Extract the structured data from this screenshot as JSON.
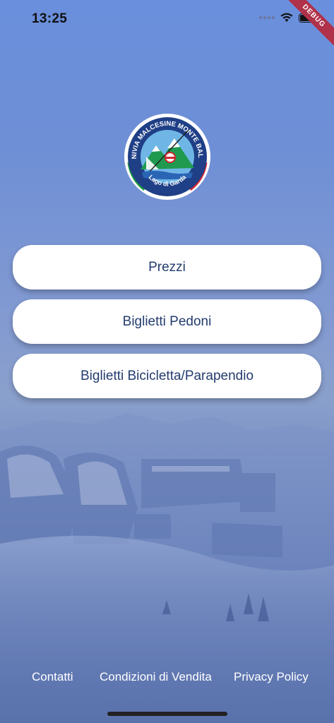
{
  "status_bar": {
    "time": "13:25",
    "icons": [
      "signal-icon",
      "wifi-icon",
      "battery-icon"
    ],
    "debug_label": "DEBUG"
  },
  "logo": {
    "top_text": "FUNIVIA MALCESINE MONTE BALDO",
    "bottom_text": "Lago di Garda"
  },
  "buttons": [
    {
      "label": "Prezzi"
    },
    {
      "label": "Biglietti Pedoni"
    },
    {
      "label": "Biglietti Bicicletta/Parapendio"
    }
  ],
  "footer": {
    "links": [
      {
        "label": "Contatti"
      },
      {
        "label": "Condizioni di Vendita"
      },
      {
        "label": "Privacy Policy"
      }
    ]
  },
  "colors": {
    "button_text": "#233c6e",
    "debug_ribbon": "#b0314a",
    "footer_text": "#ffffff"
  }
}
